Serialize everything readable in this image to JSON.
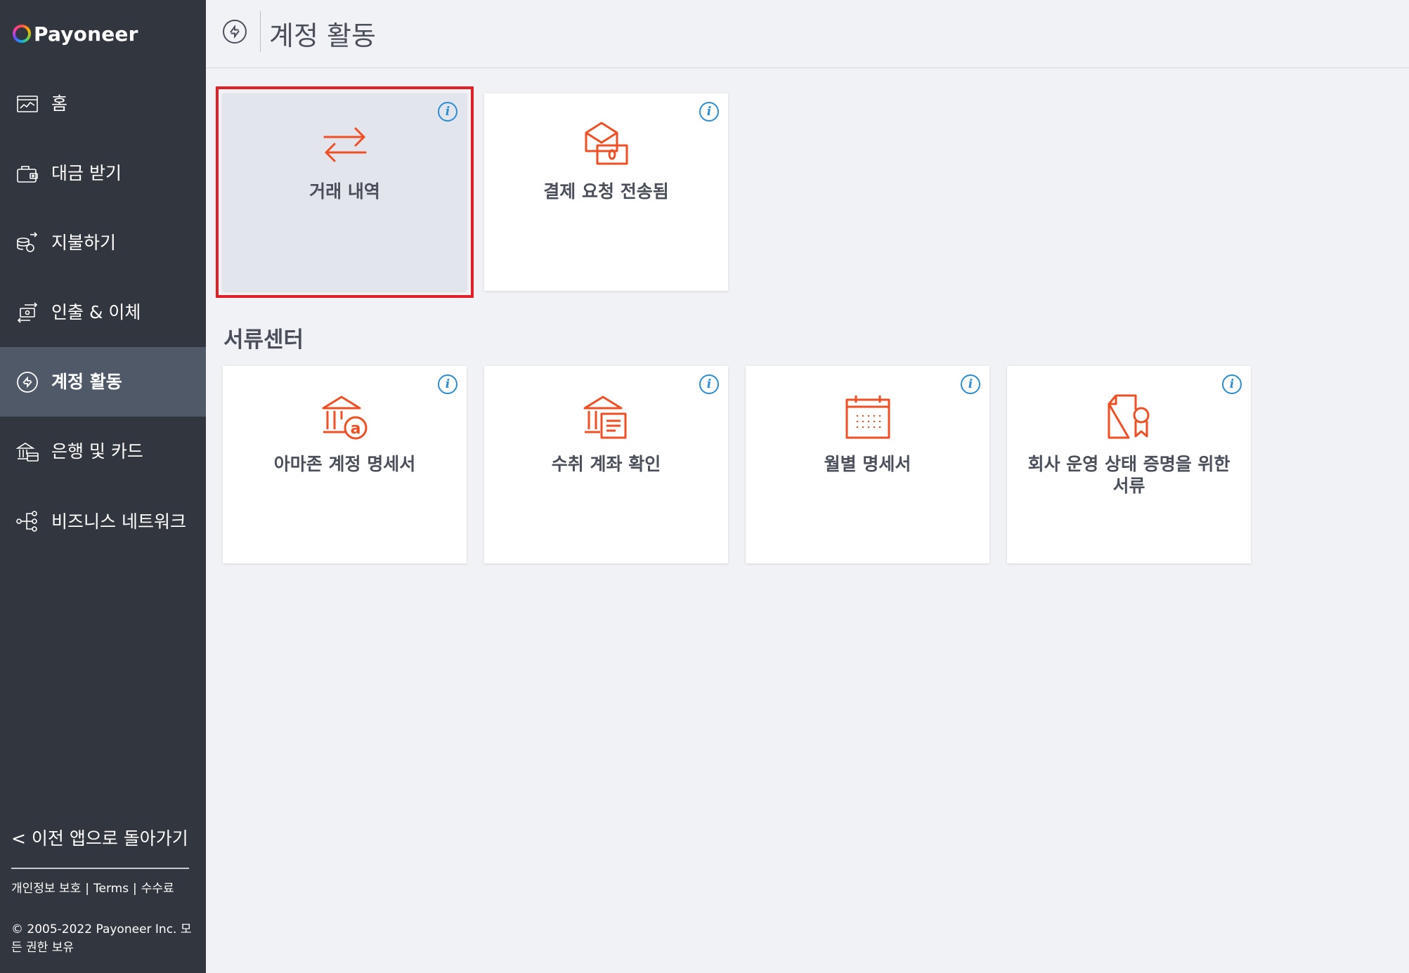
{
  "brand": {
    "name": "Payoneer"
  },
  "sidebar": {
    "items": [
      {
        "label": "홈",
        "icon": "chart-icon"
      },
      {
        "label": "대금 받기",
        "icon": "wallet-icon"
      },
      {
        "label": "지불하기",
        "icon": "coins-send-icon"
      },
      {
        "label": "인출 & 이체",
        "icon": "transfer-icon"
      },
      {
        "label": "계정 활동",
        "icon": "activity-icon",
        "active": true
      },
      {
        "label": "은행 및 카드",
        "icon": "bank-card-icon"
      },
      {
        "label": "비즈니스 네트워크",
        "icon": "network-icon"
      }
    ],
    "back_link": "< 이전 앱으로 돌아가기",
    "footer": {
      "privacy": "개인정보 보호",
      "terms": "Terms",
      "fees": "수수료",
      "copyright": "© 2005-2022 Payoneer Inc. 모든 권한 보유"
    }
  },
  "header": {
    "title": "계정 활동"
  },
  "activity_cards": [
    {
      "label": "거래 내역",
      "icon": "arrows-exchange-icon",
      "selected": true
    },
    {
      "label": "결제 요청 전송됨",
      "icon": "envelope-money-icon"
    }
  ],
  "documents": {
    "title": "서류센터",
    "cards": [
      {
        "label": "아마존 계정 명세서",
        "icon": "bank-amazon-icon"
      },
      {
        "label": "수취 계좌 확인",
        "icon": "bank-document-icon"
      },
      {
        "label": "월별 명세서",
        "icon": "calendar-icon"
      },
      {
        "label": "회사 운영 상태 증명을 위한 서류",
        "icon": "certificate-icon"
      }
    ]
  },
  "colors": {
    "sidebar_bg": "#32363e",
    "active_bg": "#4f5968",
    "accent": "#f04e23",
    "info": "#2a8ed6",
    "highlight": "#e01f26"
  }
}
